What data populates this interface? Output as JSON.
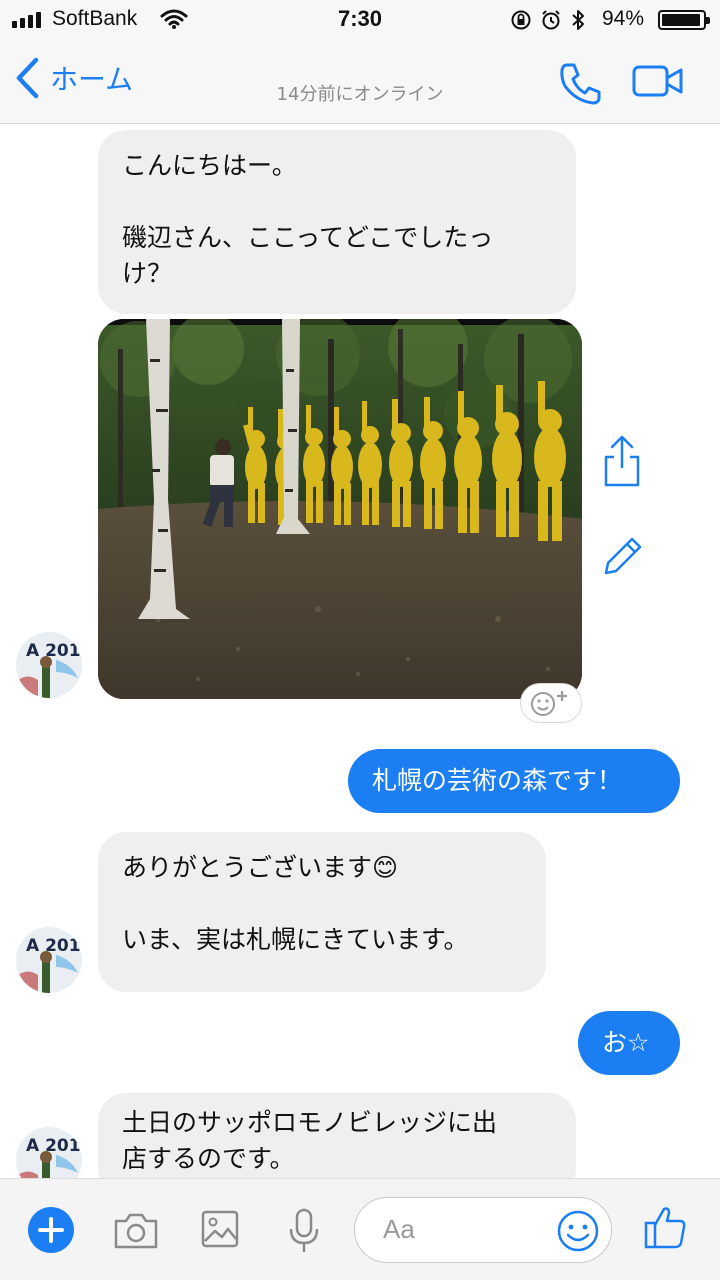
{
  "status_bar": {
    "carrier": "SoftBank",
    "time": "7:30",
    "battery_percent": "94%",
    "battery_level": 0.94
  },
  "nav": {
    "back_label": "ホーム",
    "subtitle": "14分前にオンライン",
    "icons": [
      "chevron-left-icon",
      "phone-icon",
      "video-camera-icon"
    ],
    "accent_color": "#1b7ef2"
  },
  "messages": [
    {
      "direction": "in",
      "lines": [
        "こんにちはー。",
        "",
        "磯辺さん、ここってどこでしたっ",
        "け？"
      ]
    },
    {
      "direction": "in",
      "type": "photo",
      "icons": [
        "share-icon",
        "edit-pencil-icon",
        "add-reaction-icon"
      ]
    },
    {
      "direction": "out",
      "lines": [
        "札幌の芸術の森です！"
      ]
    },
    {
      "direction": "in",
      "lines": [
        "ありがとうございます😊",
        "",
        "いま、実は札幌にきています。"
      ]
    },
    {
      "direction": "out",
      "lines": [
        "お☆"
      ]
    },
    {
      "direction": "in",
      "lines": [
        "土日のサッポロモノビレッジに出",
        "店するのです。"
      ]
    }
  ],
  "composer": {
    "placeholder": "Aa",
    "icons": [
      "plus-icon",
      "camera-icon",
      "image-icon",
      "microphone-icon",
      "smiley-icon",
      "thumbs-up-icon"
    ]
  },
  "colors": {
    "incoming_bubble": "#efefef",
    "outgoing_bubble": "#1b7ef2",
    "bar_background": "#f7f7f7"
  }
}
